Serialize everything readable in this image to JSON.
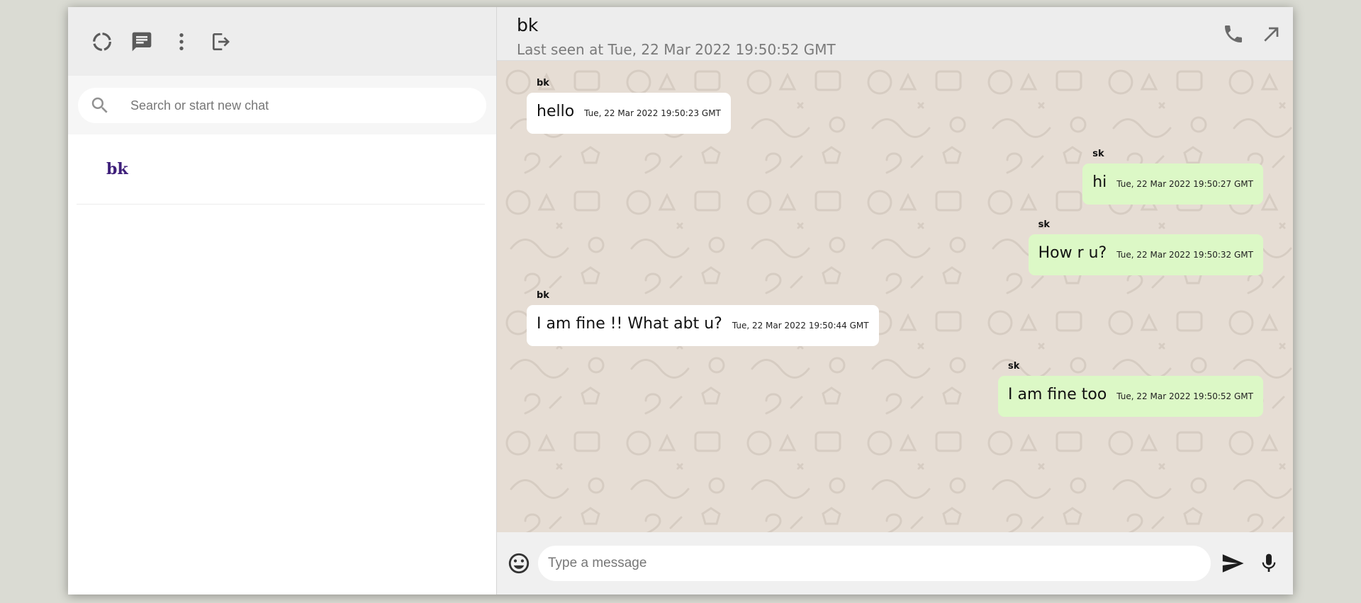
{
  "sidebar": {
    "icons": [
      "status-icon",
      "chat-icon",
      "more-menu-icon",
      "logout-icon"
    ],
    "search": {
      "placeholder": "Search or start new chat"
    },
    "chats": [
      {
        "name": "bk"
      }
    ]
  },
  "chat": {
    "contact_name": "bk",
    "last_seen": "Last seen at Tue, 22 Mar 2022 19:50:52 GMT",
    "header_icons": [
      "phone-icon",
      "expand-icon"
    ],
    "messages": [
      {
        "sender": "bk",
        "text": "hello",
        "time": "Tue, 22 Mar 2022 19:50:23 GMT",
        "direction": "in"
      },
      {
        "sender": "sk",
        "text": "hi",
        "time": "Tue, 22 Mar 2022 19:50:27 GMT",
        "direction": "out"
      },
      {
        "sender": "sk",
        "text": "How r u?",
        "time": "Tue, 22 Mar 2022 19:50:32 GMT",
        "direction": "out"
      },
      {
        "sender": "bk",
        "text": "I am fine !! What abt u?",
        "time": "Tue, 22 Mar 2022 19:50:44 GMT",
        "direction": "in"
      },
      {
        "sender": "sk",
        "text": "I am fine too",
        "time": "Tue, 22 Mar 2022 19:50:52 GMT",
        "direction": "out"
      }
    ],
    "composer": {
      "placeholder": "Type a message",
      "icons": [
        "emoji-icon",
        "send-icon",
        "mic-icon"
      ]
    }
  },
  "colors": {
    "page_bg": "#dadbd3",
    "header_bg": "#ededed",
    "chat_bg": "#e6ddd4",
    "incoming_bubble": "#ffffff",
    "outgoing_bubble": "#dcf8c6",
    "chat_name_accent": "#3e1f7a"
  }
}
